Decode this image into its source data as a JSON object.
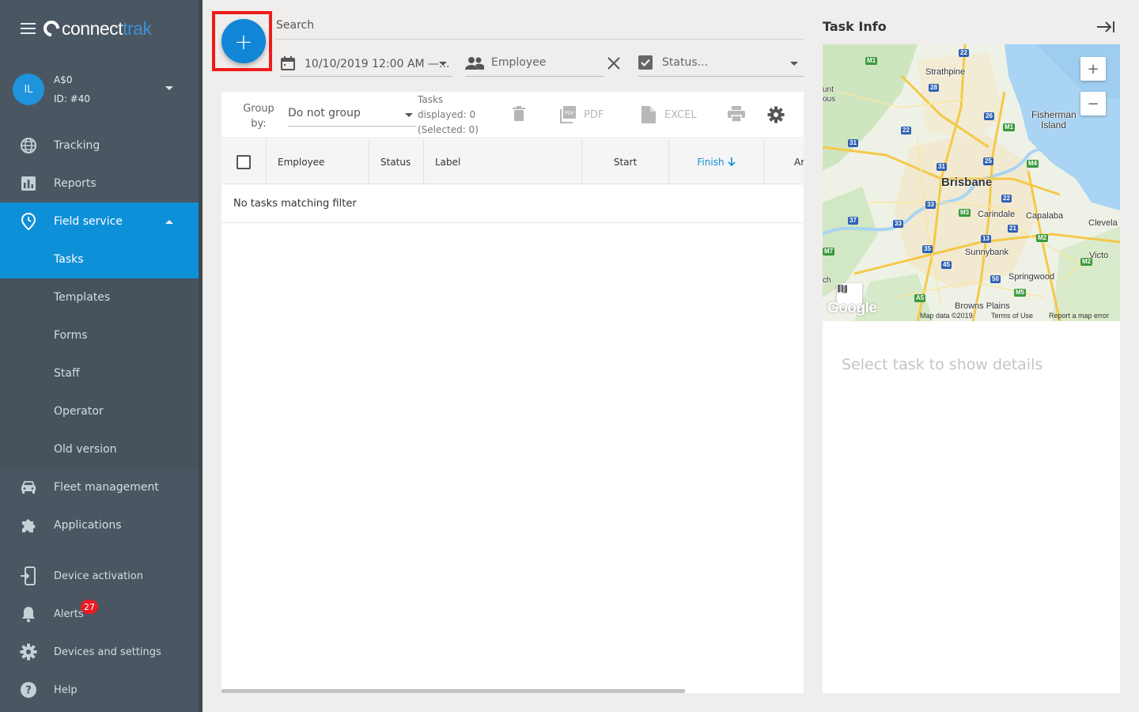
{
  "app": {
    "brand_left": "connect",
    "brand_right": "trak"
  },
  "profile": {
    "initials": "IL",
    "name": "A$0",
    "id": "ID: #40"
  },
  "nav": {
    "tracking": "Tracking",
    "reports": "Reports",
    "field_service": "Field service",
    "tasks": "Tasks",
    "templates": "Templates",
    "forms": "Forms",
    "staff": "Staff",
    "operator": "Operator",
    "old_version": "Old version",
    "fleet": "Fleet management",
    "applications": "Applications",
    "device_activation": "Device activation",
    "alerts": "Alerts",
    "alerts_count": "27",
    "devices": "Devices and settings",
    "help": "Help"
  },
  "toolbar": {
    "add_label": "+",
    "search_placeholder": "Search",
    "date_range": "10/10/2019 12:00 AM —...",
    "employee": "Employee",
    "status": "Status..."
  },
  "table_toolbar": {
    "group_by_label": "Group by:",
    "group_by_value": "Do not group",
    "tasks_line1": "Tasks",
    "tasks_line2": "displayed: 0",
    "tasks_line3": "(Selected: 0)",
    "pdf_label": "PDF",
    "excel_label": "EXCEL"
  },
  "table": {
    "columns": [
      "Employee",
      "Status",
      "Label",
      "Start",
      "Finish",
      "Ar"
    ],
    "empty_message": "No tasks matching filter"
  },
  "task_info": {
    "title": "Task Info",
    "placeholder": "Select task to show details",
    "map": {
      "zoom_in": "+",
      "zoom_out": "−",
      "labels": [
        "Strathpine",
        "Fisherman",
        "Island",
        "Brisbane",
        "Carindale",
        "Capalaba",
        "Clevela",
        "Sunnybank",
        "Springwood",
        "Browns Plains",
        "Victo",
        "unt",
        "ous",
        "ch"
      ],
      "route_shields": [
        "M1",
        "22",
        "28",
        "26",
        "M1",
        "31",
        "22",
        "31",
        "25",
        "M4",
        "22",
        "33",
        "37",
        "33",
        "M3",
        "13",
        "21",
        "M2",
        "M7",
        "35",
        "45",
        "M2",
        "50",
        "M5",
        "A5"
      ],
      "google": "Google",
      "map_data": "Map data ©2019",
      "terms": "Terms of Use",
      "report": "Report a map error"
    }
  }
}
